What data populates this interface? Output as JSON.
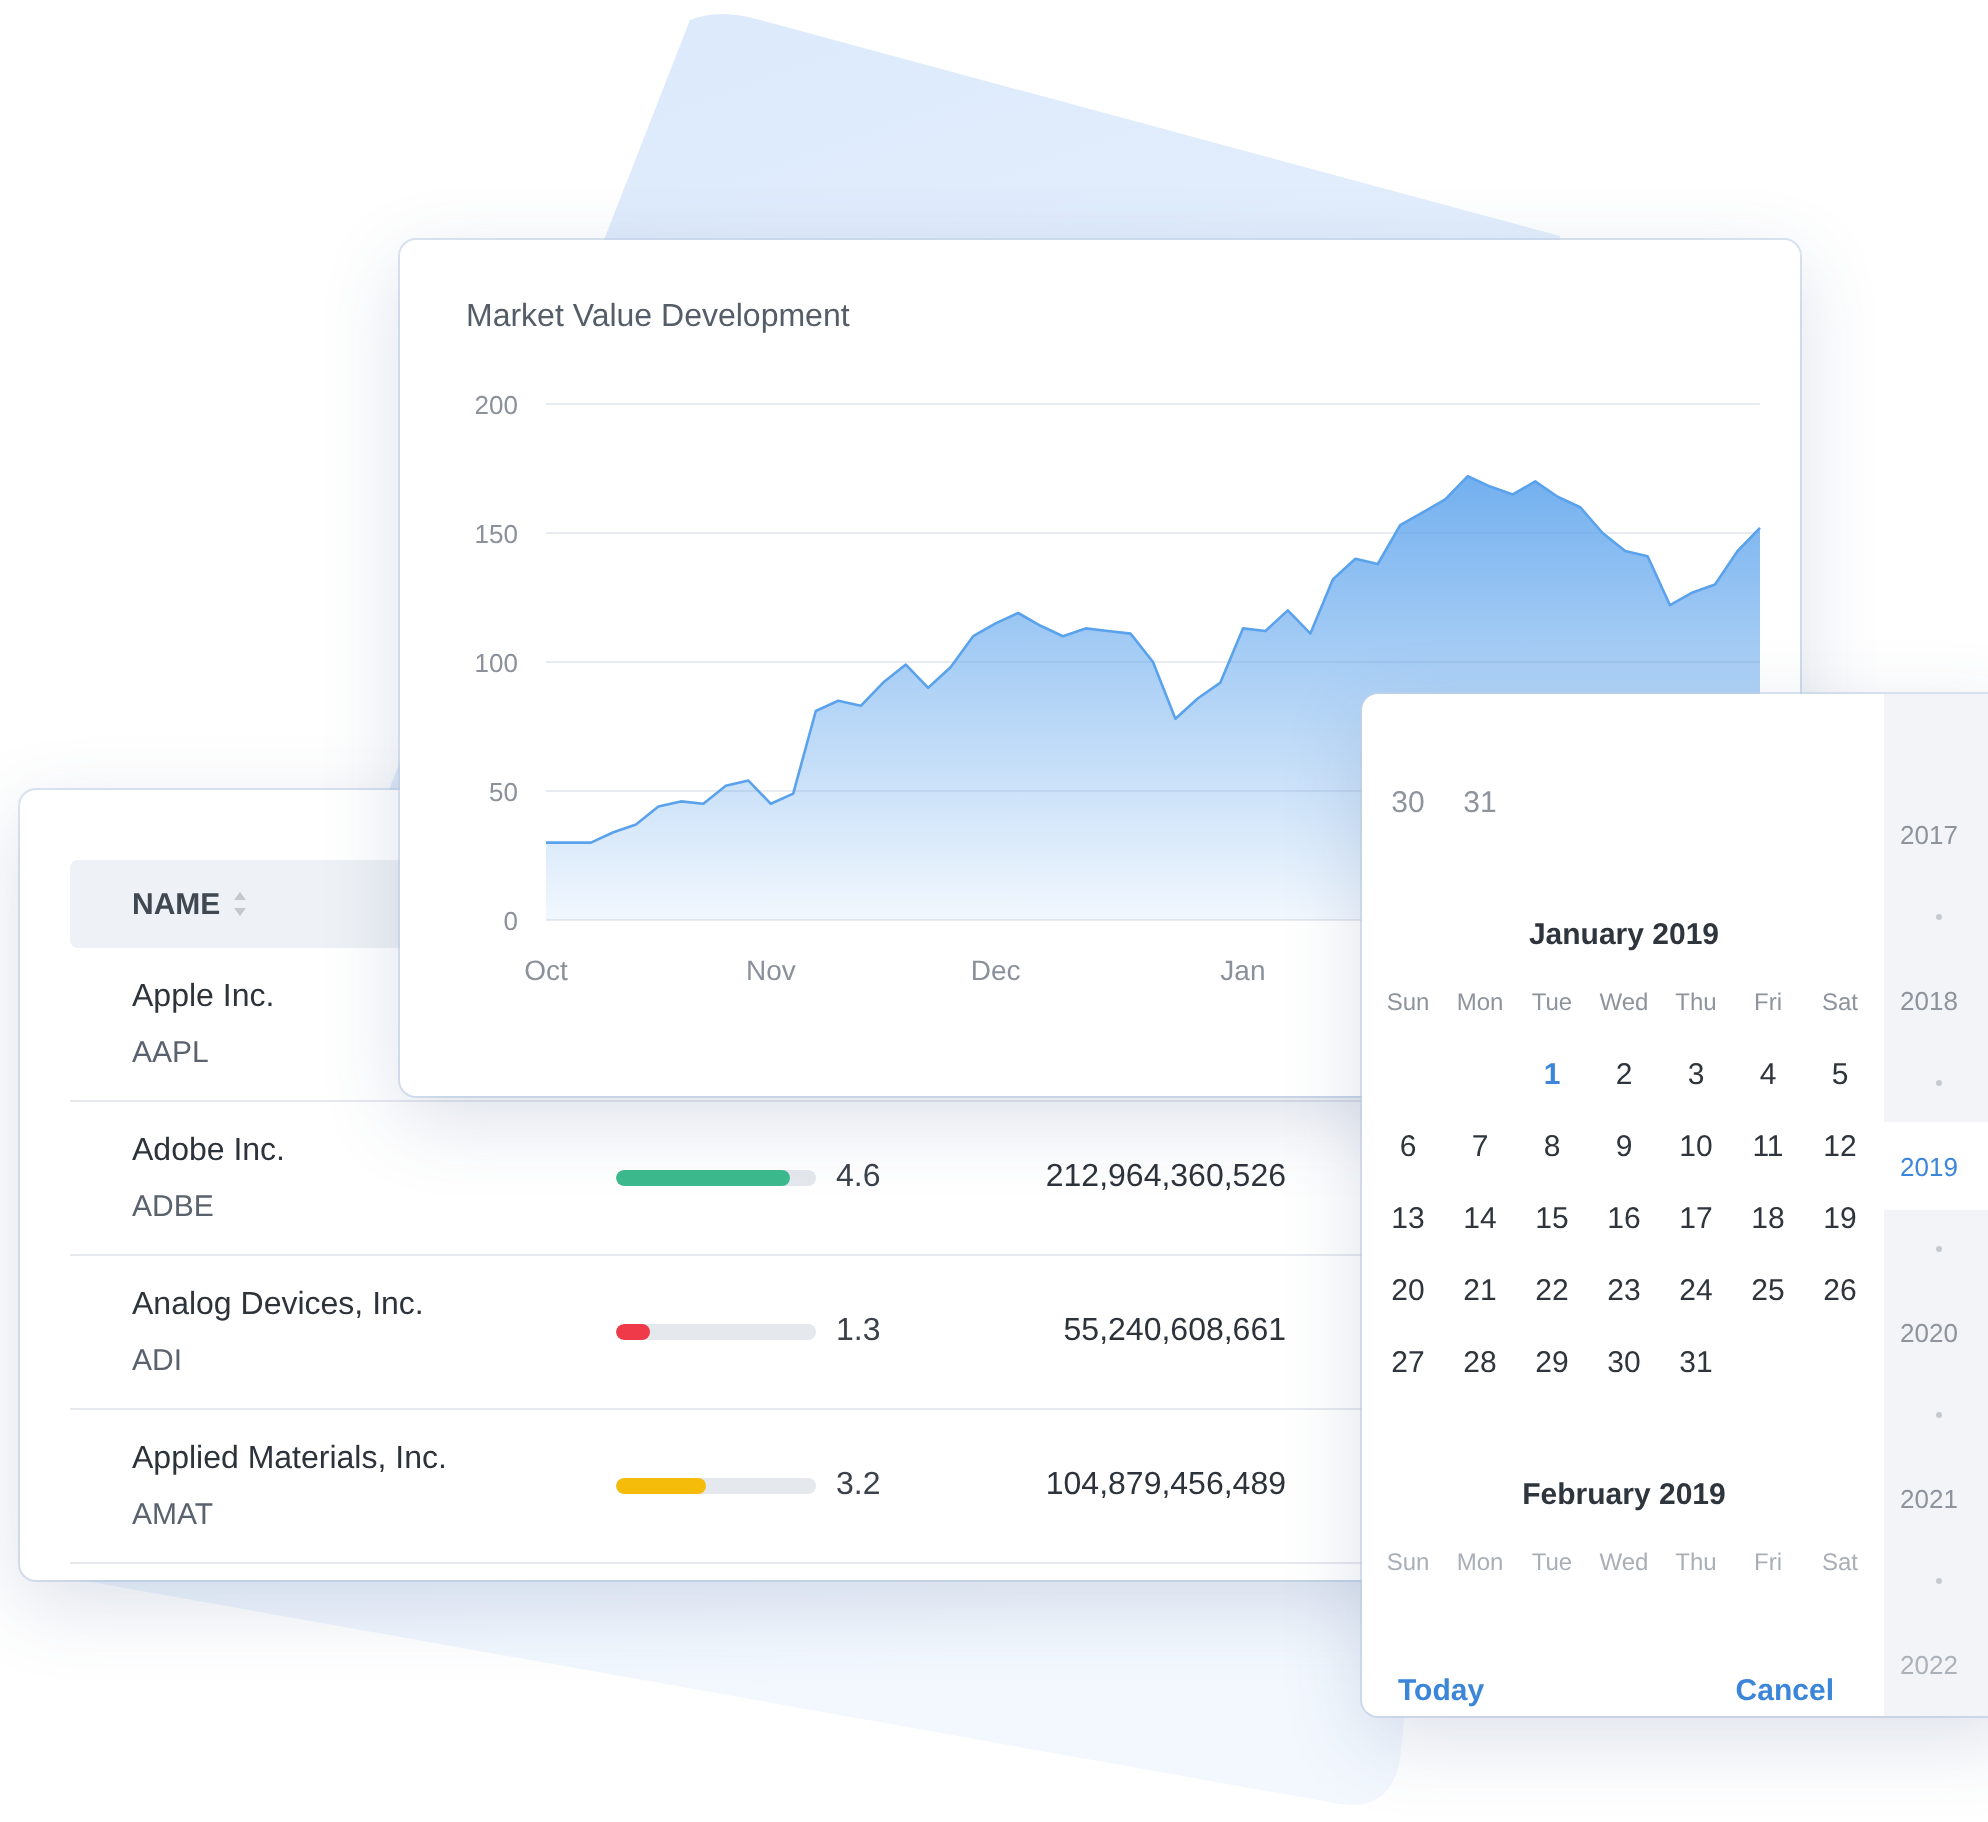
{
  "chart_card": {
    "title": "Market Value Development",
    "chart_data": {
      "type": "area",
      "categories": [
        "Oct",
        null,
        null,
        null,
        null,
        null,
        null,
        null,
        null,
        null,
        "Nov",
        null,
        null,
        null,
        null,
        null,
        null,
        null,
        null,
        null,
        "Dec",
        null,
        null,
        null,
        null,
        null,
        null,
        null,
        null,
        null,
        null,
        "Jan",
        null,
        null,
        null,
        null,
        null,
        null,
        null,
        null,
        null,
        null,
        null,
        null,
        null,
        null,
        null,
        null,
        null,
        null,
        null,
        null,
        null,
        null,
        null
      ],
      "series": [
        {
          "color": "#5aa2ec",
          "values": [
            30,
            30,
            30,
            34,
            37,
            44,
            46,
            45,
            52,
            54,
            45,
            49,
            81,
            85,
            83,
            92,
            99,
            90,
            98,
            110,
            115,
            119,
            114,
            110,
            113,
            112,
            111,
            100,
            78,
            86,
            92,
            113,
            112,
            120,
            111,
            132,
            140,
            138,
            153,
            158,
            163,
            172,
            168,
            165,
            170,
            164,
            160,
            150,
            143,
            141,
            122,
            127,
            130,
            143,
            152
          ]
        }
      ],
      "ylim": [
        0,
        200
      ],
      "yticks": [
        0,
        50,
        100,
        150,
        200
      ],
      "grid": true
    }
  },
  "table": {
    "columns": [
      {
        "label": "NAME"
      }
    ],
    "rows": [
      {
        "name": "Apple Inc.",
        "ticker": "AAPL"
      },
      {
        "name": "Adobe Inc.",
        "ticker": "ADBE",
        "level": 0.87,
        "color": "#3dba8e",
        "rating": "4.6",
        "value": "212,964,360,526"
      },
      {
        "name": "Analog Devices, Inc.",
        "ticker": "ADI",
        "level": 0.17,
        "color": "#ef3a4a",
        "rating": "1.3",
        "value": "55,240,608,661"
      },
      {
        "name": "Applied Materials, Inc.",
        "ticker": "AMAT",
        "level": 0.45,
        "color": "#f5bd0a",
        "rating": "3.2",
        "value": "104,879,456,489"
      }
    ]
  },
  "calendar": {
    "months": [
      {
        "kind": "tail",
        "weeks": [
          [
            {
              "day": "30",
              "today": false
            },
            {
              "day": "31",
              "today": false
            }
          ]
        ]
      },
      {
        "kind": "full",
        "title": "January 2019",
        "weekdays": [
          "Sun",
          "Mon",
          "Tue",
          "Wed",
          "Thu",
          "Fri",
          "Sat"
        ],
        "weeks": [
          [
            {
              "day": "1",
              "today": true
            },
            {
              "day": "2",
              "today": false
            },
            {
              "day": "3",
              "today": false
            },
            {
              "day": "4",
              "today": false
            },
            {
              "day": "5",
              "today": false
            }
          ],
          [
            {
              "day": "6",
              "today": false
            },
            {
              "day": "7",
              "today": false
            },
            {
              "day": "8",
              "today": false
            },
            {
              "day": "9",
              "today": false
            },
            {
              "day": "10",
              "today": false
            },
            {
              "day": "11",
              "today": false
            },
            {
              "day": "12",
              "today": false
            }
          ],
          [
            {
              "day": "13",
              "today": false
            },
            {
              "day": "14",
              "today": false
            },
            {
              "day": "15",
              "today": false
            },
            {
              "day": "16",
              "today": false
            },
            {
              "day": "17",
              "today": false
            },
            {
              "day": "18",
              "today": false
            },
            {
              "day": "19",
              "today": false
            }
          ],
          [
            {
              "day": "20",
              "today": false
            },
            {
              "day": "21",
              "today": false
            },
            {
              "day": "22",
              "today": false
            },
            {
              "day": "23",
              "today": false
            },
            {
              "day": "24",
              "today": false
            },
            {
              "day": "25",
              "today": false
            },
            {
              "day": "26",
              "today": false
            }
          ],
          [
            {
              "day": "27",
              "today": false
            },
            {
              "day": "28",
              "today": false
            },
            {
              "day": "29",
              "today": false
            },
            {
              "day": "30",
              "today": false
            },
            {
              "day": "31",
              "today": false
            }
          ]
        ]
      },
      {
        "kind": "header",
        "title": "February 2019",
        "weekdays": [
          "Sun",
          "Mon",
          "Tue",
          "Wed",
          "Thu",
          "Fri",
          "Sat"
        ]
      }
    ],
    "years": [
      {
        "label": "2017",
        "selected": false
      },
      {
        "label": "2018",
        "selected": false
      },
      {
        "label": "2019",
        "selected": true
      },
      {
        "label": "2020",
        "selected": false
      },
      {
        "label": "2021",
        "selected": false
      },
      {
        "label": "2022",
        "selected": false
      }
    ],
    "buttons": [
      "Today",
      "Cancel"
    ]
  }
}
